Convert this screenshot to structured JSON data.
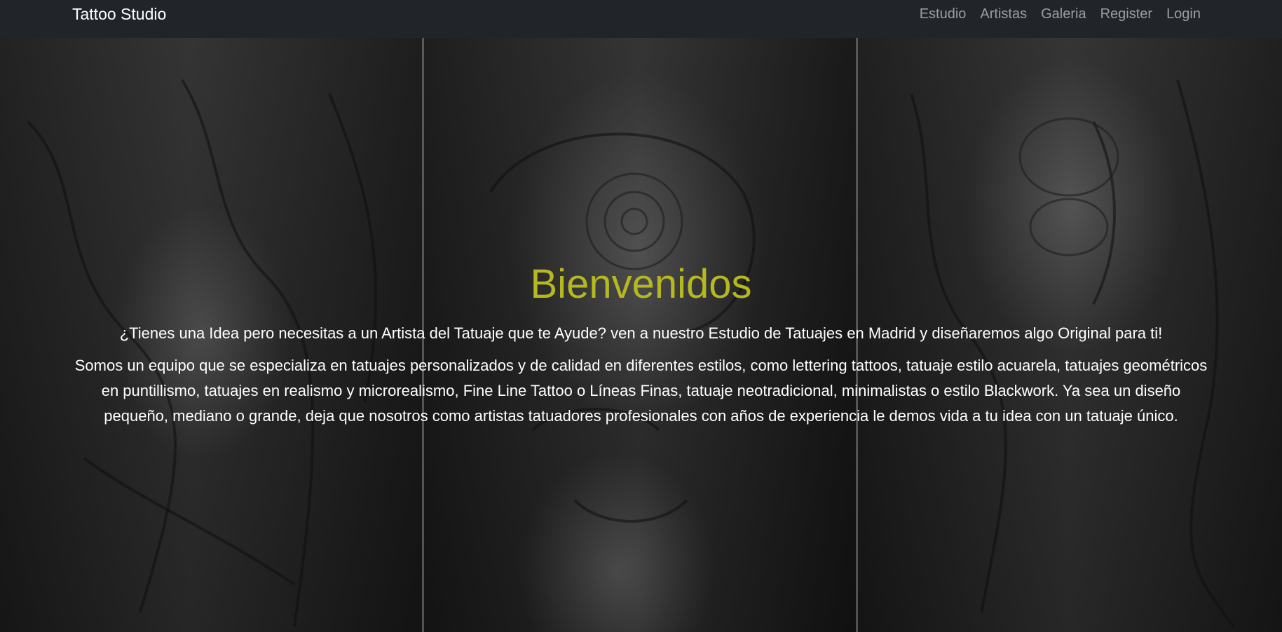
{
  "navbar": {
    "brand": "Tattoo Studio",
    "links": [
      {
        "label": "Estudio"
      },
      {
        "label": "Artistas"
      },
      {
        "label": "Galeria"
      },
      {
        "label": "Register"
      },
      {
        "label": "Login"
      }
    ]
  },
  "hero": {
    "title": "Bienvenidos",
    "lead": "¿Tienes una Idea pero necesitas a un Artista del Tatuaje que te Ayude? ven a nuestro Estudio de Tatuajes en Madrid y diseñaremos algo Original para ti!",
    "body": "Somos un equipo que se especializa en tatuajes personalizados y de calidad en diferentes estilos, como lettering tattoos, tatuaje estilo acuarela, tatuajes geométricos en puntillismo, tatuajes en realismo y microrealismo, Fine Line Tattoo o Líneas Finas, tatuaje neotradicional, minimalistas o estilo Blackwork. Ya sea un diseño pequeño, mediano o grande, deja que nosotros como artistas tatuadores profesionales con años de experiencia le demos vida a tu idea con un tatuaje único.",
    "background_image": "black-and-grey-tattoo-collage"
  },
  "colors": {
    "navbar_bg": "#212529",
    "title": "#b5b81e",
    "text": "#ffffff",
    "nav_link": "rgba(255,255,255,0.55)"
  }
}
